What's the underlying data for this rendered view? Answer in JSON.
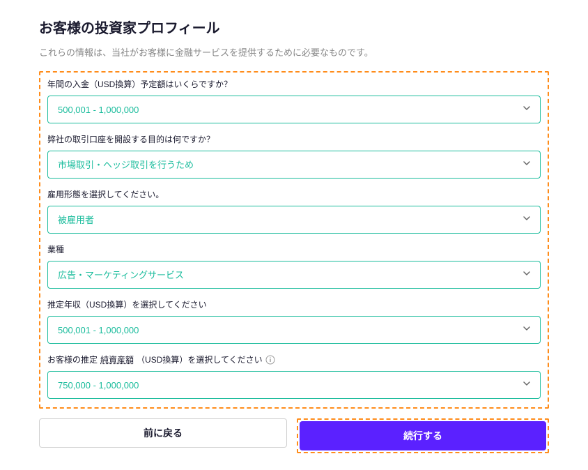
{
  "page": {
    "title": "お客様の投資家プロフィール",
    "subtitle": "これらの情報は、当社がお客様に金融サービスを提供するために必要なものです。"
  },
  "fields": {
    "deposit": {
      "label": "年間の入金（USD換算）予定額はいくらですか？",
      "value": "500,001 - 1,000,000"
    },
    "purpose": {
      "label": "弊社の取引口座を開設する目的は何ですか？",
      "value": "市場取引・ヘッジ取引を行うため"
    },
    "employment": {
      "label": "雇用形態を選択してください。",
      "value": "被雇用者"
    },
    "industry": {
      "label": "業種",
      "value": "広告・マーケティングサービス"
    },
    "income": {
      "label": "推定年収（USD換算）を選択してください",
      "value": "500,001 - 1,000,000"
    },
    "networth": {
      "label_prefix": "お客様の推定",
      "label_underlined": "純資産額",
      "label_suffix": "（USD換算）を選択してください",
      "value": "750,000 - 1,000,000"
    }
  },
  "buttons": {
    "back": "前に戻る",
    "continue": "続行する"
  }
}
